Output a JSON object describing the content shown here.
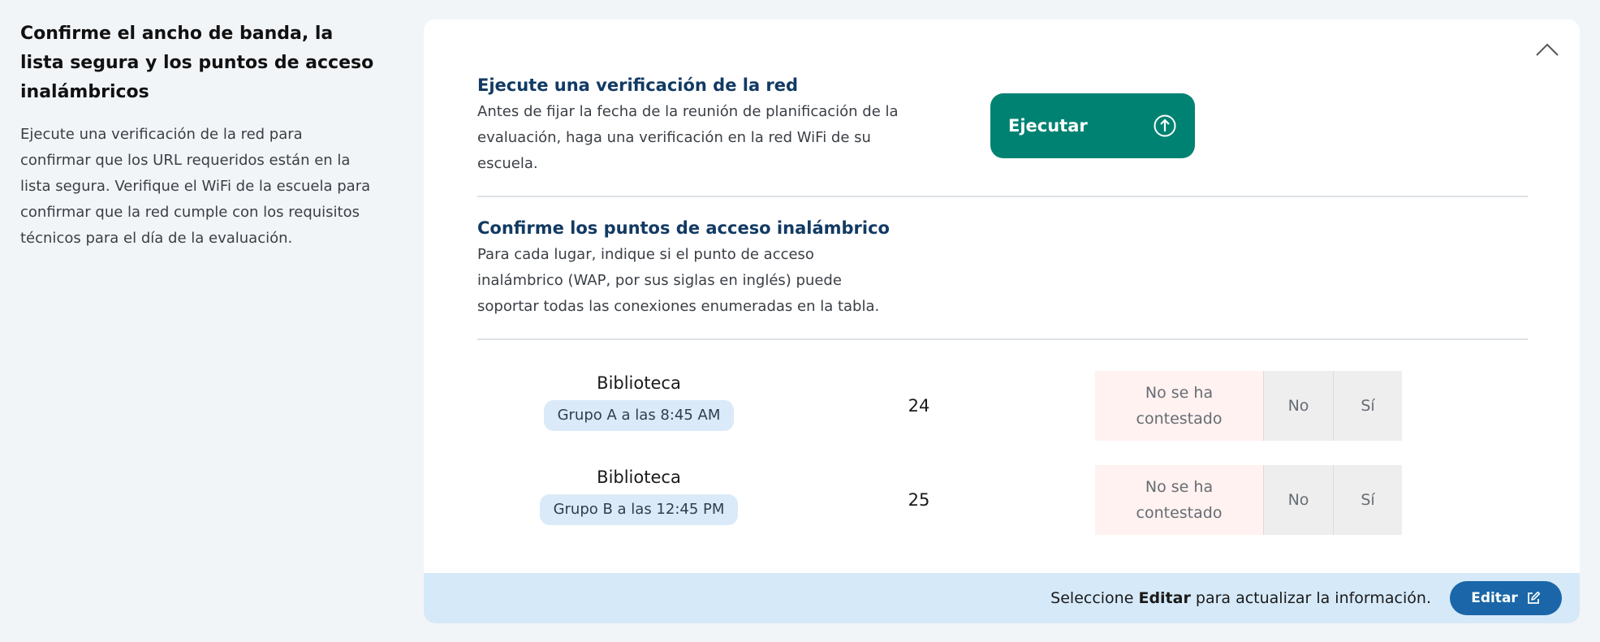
{
  "section": {
    "title": "Confirme el ancho de banda, la lista segura y los puntos de acceso inalámbricos",
    "description": "Ejecute una verificación de la red para confirmar que los URL requeridos están en la lista segura. Verifique el WiFi de la escuela para confirmar que la red cumple con los requisitos técnicos para el día de la evaluación."
  },
  "card": {
    "collapse_icon": "chevron-up-icon",
    "network_check": {
      "title": "Ejecute una verificación de la red",
      "description": "Antes de fijar la fecha de la reunión de planificación de la evaluación, haga una verificación en la red WiFi de su escuela.",
      "run_button_label": "Ejecutar",
      "run_button_icon": "arrow-up-circle-icon"
    },
    "access_points": {
      "title": "Confirme los puntos de acceso inalámbrico",
      "description": "Para cada lugar, indique si el punto de acceso inalámbrico (WAP, por sus siglas en inglés) puede soportar todas las conexiones enumeradas en la tabla."
    },
    "rows": [
      {
        "location": "Biblioteca",
        "group": "Grupo A a las 8:45 AM",
        "count": "24",
        "answer_none": "No se ha contestado",
        "answer_no": "No",
        "answer_yes": "Sí"
      },
      {
        "location": "Biblioteca",
        "group": "Grupo B a las 12:45 PM",
        "count": "25",
        "answer_none": "No se ha contestado",
        "answer_no": "No",
        "answer_yes": "Sí"
      }
    ],
    "footer": {
      "message_prefix": "Seleccione ",
      "message_bold": "Editar",
      "message_suffix": " para actualizar la información.",
      "edit_button_label": "Editar",
      "edit_icon": "edit-icon"
    }
  },
  "colors": {
    "run_button": "#008272",
    "edit_button": "#1a66a8",
    "heading": "#123a63",
    "footer_bg": "#d6e9f8",
    "badge_bg": "#dbeaf8",
    "unanswered_bg": "#fff2f0"
  }
}
